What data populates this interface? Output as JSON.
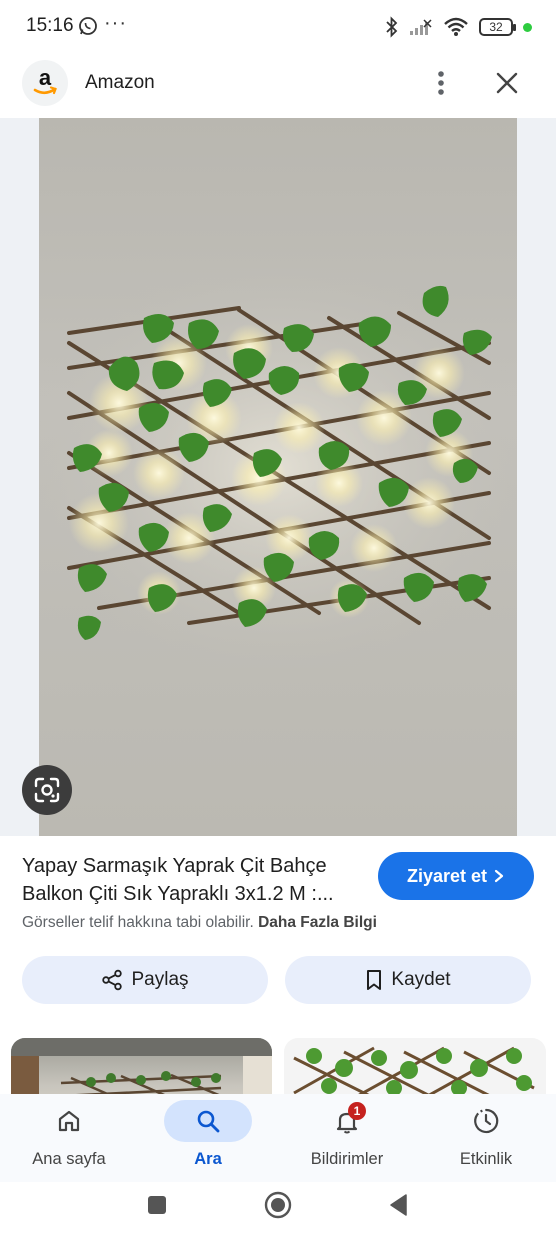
{
  "status_bar": {
    "time": "15:16",
    "more_dots": "···",
    "battery": "32",
    "dot_color": "#2ecc40"
  },
  "header": {
    "site_name": "Amazon",
    "logo_letter": "a",
    "icons": [
      "amazon-logo",
      "more-vert-icon",
      "close-icon"
    ]
  },
  "image": {
    "lens_icon": "google-lens-icon"
  },
  "result": {
    "title": "Yapay Sarmaşık Yaprak Çit Bahçe Balkon Çiti Sık Yapraklı 3x1.2 M :...",
    "visit_label": "Ziyaret et",
    "copyright_text": "Görseller telif hakkına tabi olabilir.",
    "more_info_label": "Daha Fazla Bilgi",
    "share_label": "Paylaş",
    "save_label": "Kaydet"
  },
  "bottom_nav": {
    "items": [
      {
        "label": "Ana sayfa",
        "icon": "home-icon"
      },
      {
        "label": "Ara",
        "icon": "search-icon",
        "active": true
      },
      {
        "label": "Bildirimler",
        "icon": "bell-icon",
        "badge": "1"
      },
      {
        "label": "Etkinlik",
        "icon": "activity-icon"
      }
    ]
  },
  "colors": {
    "accent": "#1a73e8",
    "active_nav": "#0b57d0",
    "pill_bg": "#e8eefb",
    "badge": "#c5221f"
  }
}
